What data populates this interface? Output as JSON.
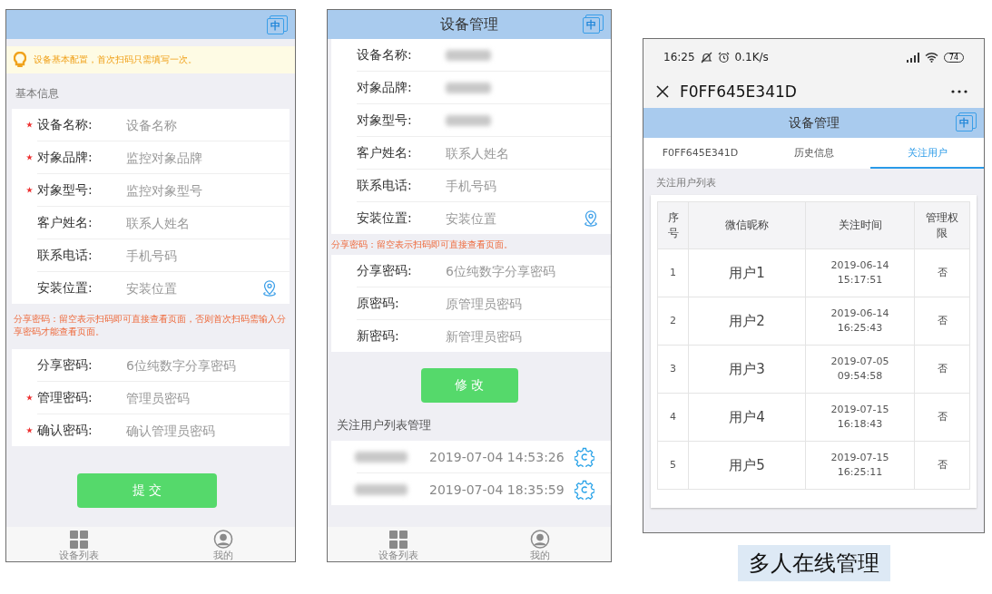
{
  "form_screen": {
    "lang_badge": "中",
    "notice": "设备基本配置，首次扫码只需填写一次。",
    "section_title": "基本信息",
    "fields": [
      {
        "label": "设备名称:",
        "placeholder": "设备名称",
        "required": true,
        "kind": "text"
      },
      {
        "label": "对象品牌:",
        "placeholder": "监控对象品牌",
        "required": true,
        "kind": "text"
      },
      {
        "label": "对象型号:",
        "placeholder": "监控对象型号",
        "required": true,
        "kind": "text"
      },
      {
        "label": "客户姓名:",
        "placeholder": "联系人姓名",
        "required": false,
        "kind": "text"
      },
      {
        "label": "联系电话:",
        "placeholder": "手机号码",
        "required": false,
        "kind": "text"
      },
      {
        "label": "安装位置:",
        "placeholder": "安装位置",
        "required": false,
        "kind": "location"
      }
    ],
    "note": "分享密码：留空表示扫码即可直接查看页面，否则首次扫码需输入分享密码才能查看页面。",
    "password_fields": [
      {
        "label": "分享密码:",
        "placeholder": "6位纯数字分享密码",
        "required": false
      },
      {
        "label": "管理密码:",
        "placeholder": "管理员密码",
        "required": true
      },
      {
        "label": "确认密码:",
        "placeholder": "确认管理员密码",
        "required": true
      }
    ],
    "button": "提 交",
    "tab_bar": [
      {
        "label": "设备列表",
        "kind": "grid"
      },
      {
        "label": "我的",
        "kind": "user"
      }
    ]
  },
  "settings_screen": {
    "title": "设备管理",
    "lang_badge": "中",
    "fields": [
      {
        "label": "设备名称:",
        "kind": "blurred"
      },
      {
        "label": "对象品牌:",
        "kind": "blurred"
      },
      {
        "label": "对象型号:",
        "kind": "blurred"
      },
      {
        "label": "客户姓名:",
        "placeholder": "联系人姓名",
        "kind": "text"
      },
      {
        "label": "联系电话:",
        "placeholder": "手机号码",
        "kind": "text"
      },
      {
        "label": "安装位置:",
        "placeholder": "安装位置",
        "kind": "location"
      }
    ],
    "note": "分享密码：留空表示扫码即可直接查看页面。",
    "password_fields": [
      {
        "label": "分享密码:",
        "placeholder": "6位纯数字分享密码"
      },
      {
        "label": "原密码:",
        "placeholder": "原管理员密码"
      },
      {
        "label": "新密码:",
        "placeholder": "新管理员密码"
      }
    ],
    "button": "修 改",
    "section_title": "关注用户列表管理",
    "followers": [
      {
        "time": "2019-07-04 14:53:26"
      },
      {
        "time": "2019-07-04 18:35:59"
      }
    ],
    "tab_bar": [
      {
        "label": "设备列表",
        "kind": "grid"
      },
      {
        "label": "我的",
        "kind": "user"
      }
    ]
  },
  "users_screen": {
    "status_bar": {
      "time": "16:25",
      "speed": "0.1K/s",
      "battery": "74"
    },
    "title": "F0FF645E341D",
    "header": "设备管理",
    "lang_badge": "中",
    "tabs": [
      {
        "label": "F0FF645E341D",
        "selected": false
      },
      {
        "label": "历史信息",
        "selected": false
      },
      {
        "label": "关注用户",
        "selected": true
      }
    ],
    "section_title": "关注用户列表",
    "table": {
      "columns": [
        "序号",
        "微信昵称",
        "关注时间",
        "管理权限"
      ],
      "rows": [
        [
          "1",
          "用户1",
          "2019-06-14 15:17:51",
          "否"
        ],
        [
          "2",
          "用户2",
          "2019-06-14 16:25:43",
          "否"
        ],
        [
          "3",
          "用户3",
          "2019-07-05 09:54:58",
          "否"
        ],
        [
          "4",
          "用户4",
          "2019-07-15 16:18:43",
          "否"
        ],
        [
          "5",
          "用户5",
          "2019-07-15 16:25:11",
          "否"
        ]
      ]
    }
  },
  "caption": "多人在线管理"
}
